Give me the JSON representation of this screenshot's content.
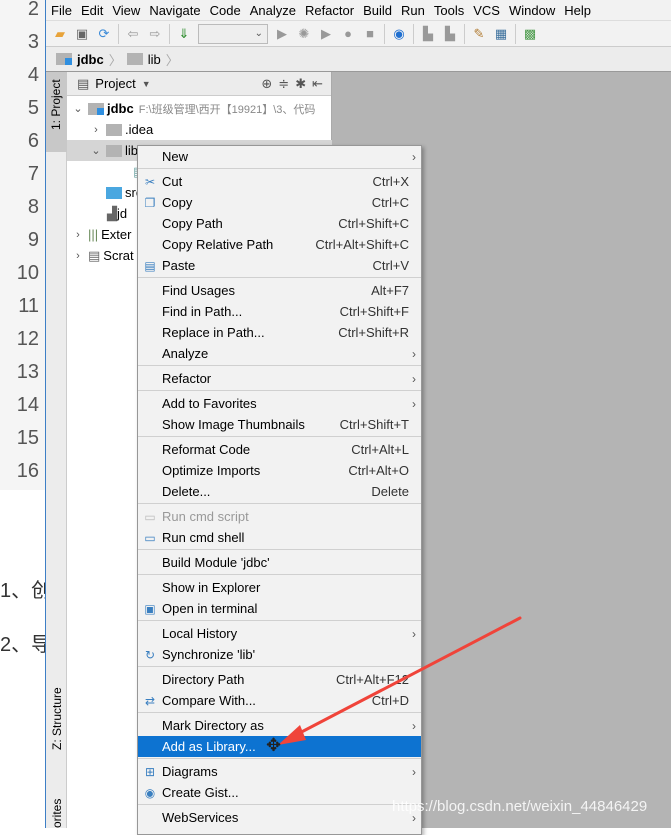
{
  "document": {
    "line_numbers": [
      "2",
      "3",
      "4",
      "5",
      "6",
      "7",
      "8",
      "9",
      "10",
      "11",
      "12",
      "13",
      "14",
      "15",
      "16"
    ],
    "text_lines": [
      "1、创",
      "2、导"
    ]
  },
  "menubar": [
    "File",
    "Edit",
    "View",
    "Navigate",
    "Code",
    "Analyze",
    "Refactor",
    "Build",
    "Run",
    "Tools",
    "VCS",
    "Window",
    "Help"
  ],
  "breadcrumb": [
    "jdbc",
    "lib"
  ],
  "tool_strip": {
    "project": "1: Project",
    "structure": "Z: Structure",
    "favorites": "orites"
  },
  "project_panel": {
    "title": "Project",
    "tree": [
      {
        "label": "jdbc",
        "path": "F:\\班级管理\\西开【19921】\\3、代码",
        "expanded": true
      },
      {
        "label": ".idea"
      },
      {
        "label": "lib",
        "expanded": true
      },
      {
        "label": "src"
      },
      {
        "label": "jd"
      },
      {
        "label": "Exter"
      },
      {
        "label": "Scrat"
      }
    ]
  },
  "context_menu": {
    "groups": [
      [
        {
          "label": "New",
          "submenu": true
        }
      ],
      [
        {
          "label": "Cut",
          "shortcut": "Ctrl+X",
          "icon": "scissors-icon"
        },
        {
          "label": "Copy",
          "shortcut": "Ctrl+C",
          "icon": "copy-icon"
        },
        {
          "label": "Copy Path",
          "shortcut": "Ctrl+Shift+C"
        },
        {
          "label": "Copy Relative Path",
          "shortcut": "Ctrl+Alt+Shift+C"
        },
        {
          "label": "Paste",
          "shortcut": "Ctrl+V",
          "icon": "paste-icon"
        }
      ],
      [
        {
          "label": "Find Usages",
          "shortcut": "Alt+F7"
        },
        {
          "label": "Find in Path...",
          "shortcut": "Ctrl+Shift+F"
        },
        {
          "label": "Replace in Path...",
          "shortcut": "Ctrl+Shift+R"
        },
        {
          "label": "Analyze",
          "submenu": true
        }
      ],
      [
        {
          "label": "Refactor",
          "submenu": true
        }
      ],
      [
        {
          "label": "Add to Favorites",
          "submenu": true
        },
        {
          "label": "Show Image Thumbnails",
          "shortcut": "Ctrl+Shift+T"
        }
      ],
      [
        {
          "label": "Reformat Code",
          "shortcut": "Ctrl+Alt+L"
        },
        {
          "label": "Optimize Imports",
          "shortcut": "Ctrl+Alt+O"
        },
        {
          "label": "Delete...",
          "shortcut": "Delete"
        }
      ],
      [
        {
          "label": "Run cmd script",
          "disabled": true,
          "icon": "cmd-icon"
        },
        {
          "label": "Run cmd shell",
          "icon": "cmd-icon"
        }
      ],
      [
        {
          "label": "Build Module 'jdbc'"
        }
      ],
      [
        {
          "label": "Show in Explorer"
        },
        {
          "label": "Open in terminal",
          "icon": "terminal-icon"
        }
      ],
      [
        {
          "label": "Local History",
          "submenu": true
        },
        {
          "label": "Synchronize 'lib'",
          "icon": "sync-icon"
        }
      ],
      [
        {
          "label": "Directory Path",
          "shortcut": "Ctrl+Alt+F12"
        },
        {
          "label": "Compare With...",
          "shortcut": "Ctrl+D",
          "icon": "compare-icon"
        }
      ],
      [
        {
          "label": "Mark Directory as",
          "submenu": true
        },
        {
          "label": "Add as Library...",
          "highlighted": true
        }
      ],
      [
        {
          "label": "Diagrams",
          "submenu": true,
          "icon": "diagram-icon"
        },
        {
          "label": "Create Gist...",
          "icon": "github-icon"
        }
      ],
      [
        {
          "label": "WebServices",
          "submenu": true
        }
      ]
    ]
  },
  "colors": {
    "highlight": "#0d73d1",
    "annotation_arrow": "#f0443a",
    "editor_bg": "#b4b4b4",
    "menu_bg": "#f2f2f2"
  },
  "watermark": "https://blog.csdn.net/weixin_44846429"
}
